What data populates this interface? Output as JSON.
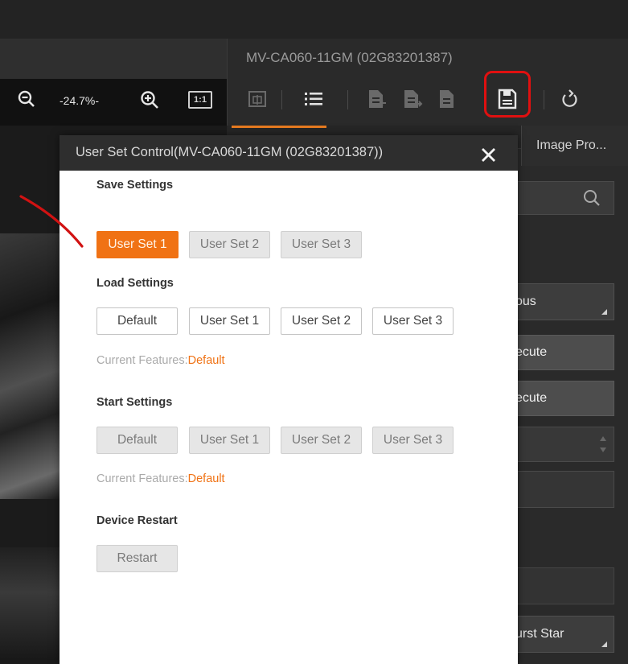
{
  "app": {
    "device_title": "MV-CA060-11GM (02G83201387)",
    "zoom_level": "-24.7%-",
    "one_to_one_label": "1:1"
  },
  "toolbar": {
    "icons": [
      "center-icon",
      "list-icon",
      "import-icon",
      "export-icon",
      "file-icon",
      "save-icon",
      "refresh-icon"
    ]
  },
  "tabs": {
    "image_tab": "Image Pro..."
  },
  "right_panel": {
    "trigger_mode_value": "ous",
    "execute_1": "ecute",
    "execute_2": "ecute",
    "burst_value": "urst Star"
  },
  "dialog": {
    "title": "User Set Control(MV-CA060-11GM (02G83201387))",
    "save": {
      "heading": "Save Settings",
      "buttons": [
        "User Set 1",
        "User Set 2",
        "User Set 3"
      ]
    },
    "load": {
      "heading": "Load Settings",
      "buttons": [
        "Default",
        "User Set 1",
        "User Set 2",
        "User Set 3"
      ],
      "current_label": "Current Features:",
      "current_value": "Default"
    },
    "start": {
      "heading": "Start Settings",
      "buttons": [
        "Default",
        "User Set 1",
        "User Set 2",
        "User Set 3"
      ],
      "current_label": "Current Features:",
      "current_value": "Default"
    },
    "restart": {
      "heading": "Device Restart",
      "button": "Restart"
    }
  },
  "colors": {
    "accent": "#f07214",
    "annotation": "#e01010"
  }
}
